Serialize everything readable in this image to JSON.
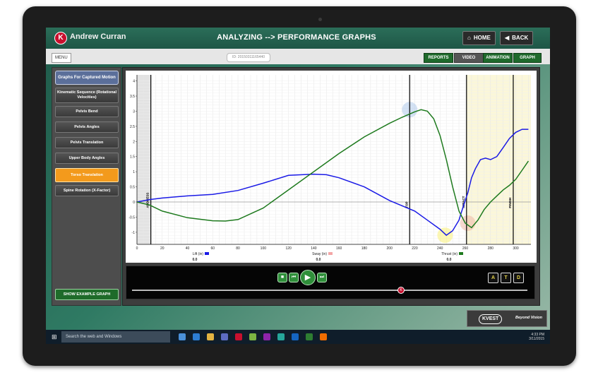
{
  "header": {
    "logo_letter": "K",
    "user_name": "Andrew Curran",
    "title": "ANALYZING --> PERFORMANCE GRAPHS",
    "home_label": "HOME",
    "back_label": "BACK"
  },
  "subbar": {
    "menu_label": "MENU",
    "session_id": "ID: 20150311165440",
    "tabs": [
      "REPORTS",
      "VIDEO",
      "ANIMATION",
      "GRAPH"
    ]
  },
  "sidebar": {
    "header": "Graphs For Captured Motion",
    "items": [
      "Kinematic Sequence (Rotational Velocities)",
      "Pelvis Bend",
      "Pelvis Angles",
      "Pelvis Translation",
      "Upper Body Angles",
      "Torso Translation",
      "Spine Rotation (X-Factor)"
    ],
    "active_index": 5,
    "example_button": "SHOW EXAMPLE GRAPH"
  },
  "chart_data": {
    "type": "line",
    "title": "",
    "xlabel": "",
    "ylabel": "",
    "xlim": [
      0,
      312
    ],
    "ylim": [
      -1.4,
      4.2
    ],
    "x_ticks": [
      0,
      20,
      40,
      60,
      80,
      100,
      120,
      140,
      160,
      180,
      200,
      220,
      240,
      260,
      280,
      300
    ],
    "y_ticks": [
      -1,
      -0.5,
      0,
      0.5,
      1,
      1.5,
      2,
      2.5,
      3,
      3.5,
      4
    ],
    "grid": true,
    "phase_markers": [
      {
        "label": "ADDRESS",
        "x": 11
      },
      {
        "label": "TOP",
        "x": 216
      },
      {
        "label": "IMPACT",
        "x": 261
      },
      {
        "label": "FINISH",
        "x": 298
      }
    ],
    "series": [
      {
        "name": "Lift (in)",
        "color": "#1a1ae6",
        "current_value": "0.0",
        "x": [
          0,
          10,
          20,
          40,
          60,
          80,
          100,
          120,
          140,
          150,
          160,
          180,
          200,
          220,
          230,
          240,
          245,
          250,
          255,
          258,
          262,
          265,
          268,
          272,
          276,
          280,
          285,
          290,
          295,
          300,
          305,
          310
        ],
        "y": [
          0,
          0.08,
          0.13,
          0.2,
          0.25,
          0.38,
          0.62,
          0.88,
          0.92,
          0.9,
          0.8,
          0.5,
          0.05,
          -0.3,
          -0.6,
          -0.9,
          -1.1,
          -0.95,
          -0.6,
          -0.2,
          0.3,
          0.8,
          1.1,
          1.4,
          1.45,
          1.4,
          1.5,
          1.8,
          2.1,
          2.3,
          2.4,
          2.4
        ]
      },
      {
        "name": "Sway (in)",
        "color": "#f4a6a6",
        "current_value": "0.0",
        "x": [
          0
        ],
        "y": [
          0
        ]
      },
      {
        "name": "Thrust (in)",
        "color": "#1e7a1e",
        "current_value": "0.0",
        "x": [
          0,
          10,
          20,
          40,
          60,
          70,
          80,
          100,
          120,
          140,
          160,
          180,
          200,
          210,
          220,
          225,
          230,
          235,
          240,
          245,
          250,
          255,
          260,
          265,
          270,
          275,
          280,
          285,
          290,
          295,
          300,
          305,
          310
        ],
        "y": [
          0,
          -0.1,
          -0.3,
          -0.52,
          -0.62,
          -0.63,
          -0.58,
          -0.2,
          0.4,
          1.0,
          1.6,
          2.15,
          2.6,
          2.8,
          2.98,
          3.05,
          3.0,
          2.75,
          2.2,
          1.4,
          0.5,
          -0.3,
          -0.7,
          -0.85,
          -0.6,
          -0.25,
          0.0,
          0.2,
          0.4,
          0.55,
          0.75,
          1.05,
          1.35
        ]
      }
    ]
  },
  "player": {
    "controls": [
      "stop",
      "prev-frame",
      "play",
      "next-frame"
    ],
    "camera_views": [
      "A",
      "T",
      "D"
    ]
  },
  "branding": {
    "logo_text": "KVEST",
    "tagline": "Beyond Vision"
  },
  "taskbar": {
    "search_placeholder": "Search the web and Windows",
    "time": "4:33 PM",
    "date": "3/11/2015"
  },
  "colors": {
    "brand_red": "#c8102e",
    "active_orange": "#f39a1c",
    "tab_green": "#1f6a2c"
  }
}
